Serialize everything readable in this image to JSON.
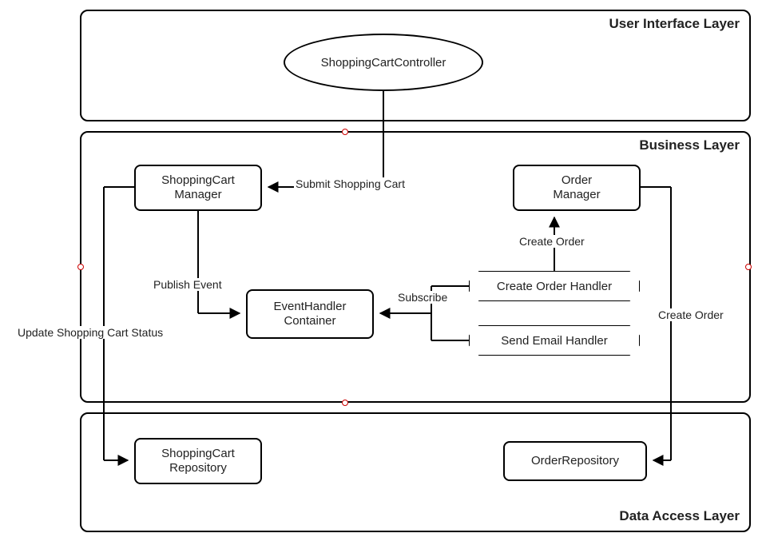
{
  "layers": {
    "ui": {
      "title": "User Interface Layer"
    },
    "business": {
      "title": "Business Layer"
    },
    "data": {
      "title": "Data Access Layer"
    }
  },
  "nodes": {
    "controller": "ShoppingCartController",
    "cartManager": "ShoppingCart\nManager",
    "orderManager": "Order\nManager",
    "eventContainer": "EventHandler\nContainer",
    "createOrderHandler": "Create Order Handler",
    "sendEmailHandler": "Send Email Handler",
    "cartRepo": "ShoppingCart\nRepository",
    "orderRepo": "OrderRepository"
  },
  "edges": {
    "submitCart": "Submit Shopping Cart",
    "publishEvent": "Publish Event",
    "subscribe": "Subscribe",
    "createOrderUp": "Create Order",
    "createOrderDown": "Create Order",
    "updateStatus": "Update Shopping Cart Status"
  }
}
